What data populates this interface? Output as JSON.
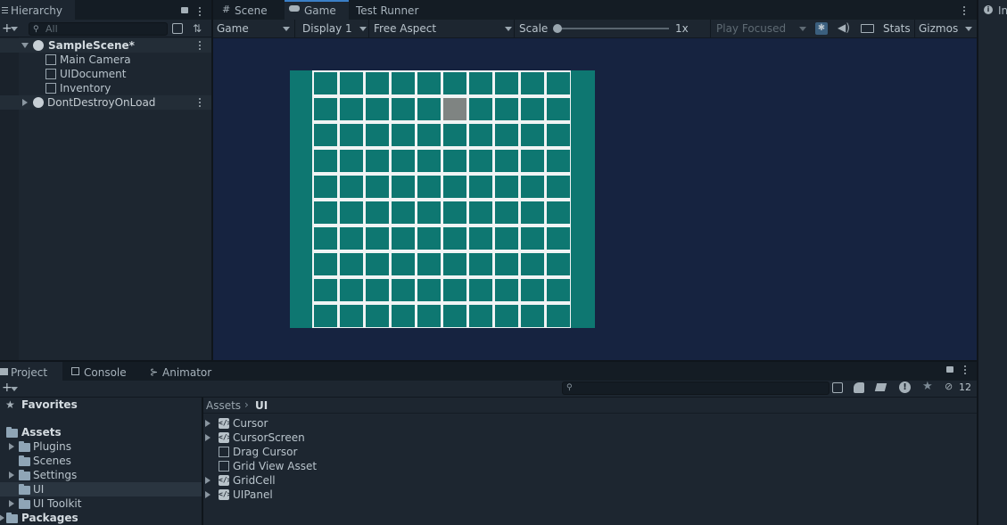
{
  "hierarchy": {
    "tab_label": "Hierarchy",
    "search_placeholder": "All",
    "items": [
      {
        "label": "SampleScene*"
      },
      {
        "label": "Main Camera"
      },
      {
        "label": "UIDocument"
      },
      {
        "label": "Inventory"
      },
      {
        "label": "DontDestroyOnLoad"
      }
    ]
  },
  "center_tabs": [
    {
      "label": "Scene"
    },
    {
      "label": "Game"
    },
    {
      "label": "Test Runner"
    }
  ],
  "game_toolbar": {
    "mode": "Game",
    "display": "Display 1",
    "aspect": "Free Aspect",
    "scale_label": "Scale",
    "scale_value": "1x",
    "play_focused": "Play Focused",
    "stats": "Stats",
    "gizmos": "Gizmos"
  },
  "inspector_tab": "In",
  "game_view": {
    "grid_cols": 10,
    "grid_rows": 10,
    "selected_cell": {
      "row": 1,
      "col": 5
    },
    "colors": {
      "background": "#162340",
      "panel": "#0e7771",
      "cell": "#0e7771",
      "selected": "#7f8482",
      "grid_lines": "#f0f4f4"
    }
  },
  "bottom_tabs": [
    {
      "label": "Project"
    },
    {
      "label": "Console"
    },
    {
      "label": "Animator"
    }
  ],
  "project": {
    "hidden_count": "12",
    "favorites_label": "Favorites",
    "tree": [
      {
        "label": "Assets"
      },
      {
        "label": "Plugins"
      },
      {
        "label": "Scenes"
      },
      {
        "label": "Settings"
      },
      {
        "label": "UI"
      },
      {
        "label": "UI Toolkit"
      },
      {
        "label": "Packages"
      }
    ],
    "breadcrumb": [
      "Assets",
      "UI"
    ],
    "files": [
      {
        "label": "Cursor",
        "icon": "script-icon"
      },
      {
        "label": "CursorScreen",
        "icon": "script-icon"
      },
      {
        "label": "Drag Cursor",
        "icon": "asset-icon"
      },
      {
        "label": "Grid View Asset",
        "icon": "asset-icon"
      },
      {
        "label": "GridCell",
        "icon": "script-icon"
      },
      {
        "label": "UIPanel",
        "icon": "script-icon"
      }
    ]
  }
}
